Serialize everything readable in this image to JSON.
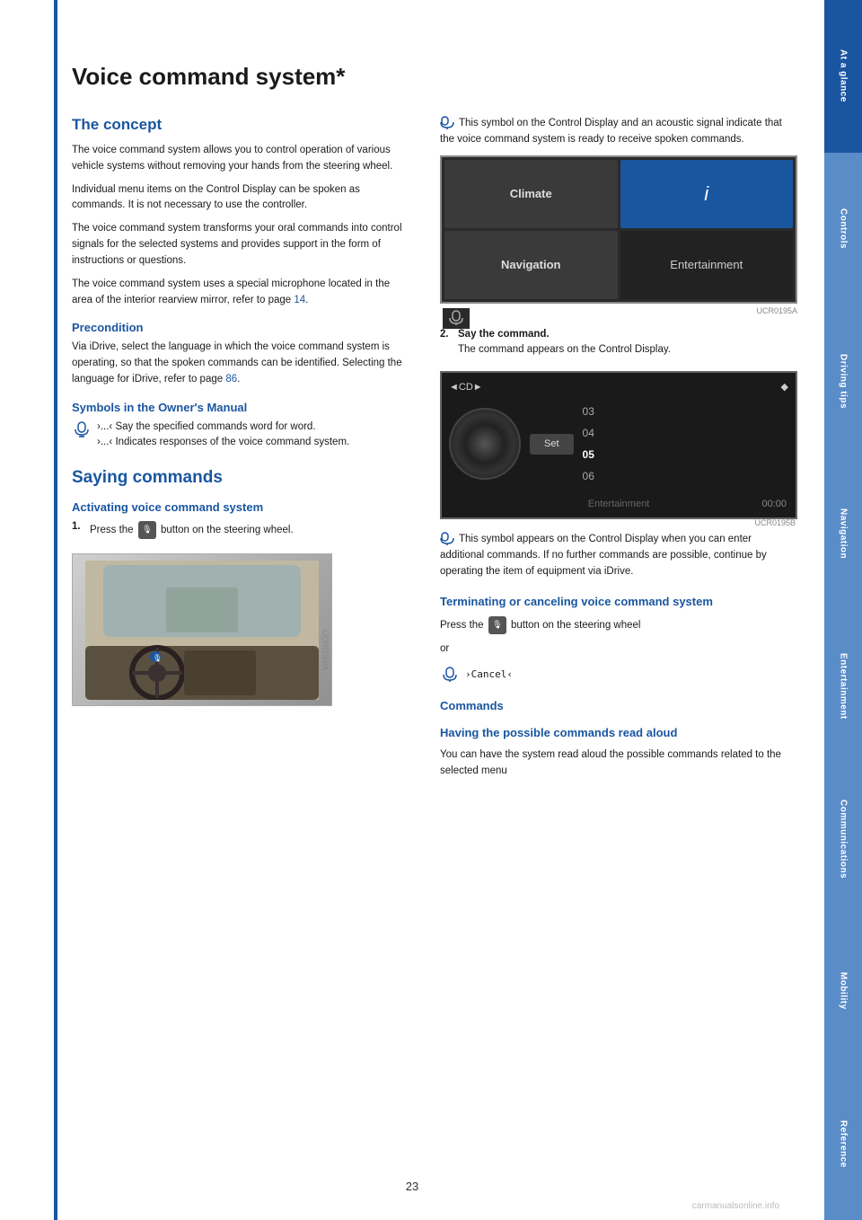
{
  "page": {
    "title": "Voice command system*",
    "page_number": "23",
    "watermark": "carmanualsonline.info"
  },
  "sidebar": {
    "items": [
      {
        "id": "s1",
        "label": "At a glance",
        "active": true
      },
      {
        "id": "s2",
        "label": "Controls"
      },
      {
        "id": "s3",
        "label": "Driving tips"
      },
      {
        "id": "s4",
        "label": "Navigation"
      },
      {
        "id": "s5",
        "label": "Entertainment"
      },
      {
        "id": "s6",
        "label": "Communications"
      },
      {
        "id": "s7",
        "label": "Mobility"
      },
      {
        "id": "s8",
        "label": "Reference"
      }
    ]
  },
  "left_col": {
    "concept_title": "The concept",
    "concept_paragraphs": [
      "The voice command system allows you to control operation of various vehicle systems without removing your hands from the steering wheel.",
      "Individual menu items on the Control Display can be spoken as commands. It is not necessary to use the controller.",
      "The voice command system transforms your oral commands into control signals for the selected systems and provides support in the form of instructions or questions.",
      "The voice command system uses a special microphone located in the area of the interior rearview mirror, refer to page 14."
    ],
    "precondition_title": "Precondition",
    "precondition_text": "Via iDrive, select the language in which the voice command system is operating, so that the spoken commands can be identified. Selecting the language for iDrive, refer to page 86.",
    "symbols_title": "Symbols in the Owner's Manual",
    "symbol1_text": "›...‹ Say the specified commands word for word.",
    "symbol2_text": "›...‹ Indicates responses of the voice command system.",
    "saying_title": "Saying commands",
    "activating_title": "Activating voice command system",
    "step1_text": "Press the",
    "step1_suffix": "button on the steering wheel.",
    "page_ref_14": "14",
    "page_ref_86": "86"
  },
  "right_col": {
    "symbol_intro": "This symbol on the Control Display and an acoustic signal indicate that the voice command system is ready to receive spoken commands.",
    "step2_label": "2.",
    "step2_text": "Say the command.",
    "step2_sub": "The command appears on the Control Display.",
    "cd_tracks": [
      "03",
      "04",
      "05",
      "06"
    ],
    "cd_time": "00:00",
    "cd_header": "◄  CD  ►",
    "cd_set": "Set",
    "entertainment_label": "Entertainment",
    "symbol_additional": "This symbol appears on the Control Display when you can enter additional commands. If no further commands are possible, continue by operating the item of equipment via iDrive.",
    "terminating_title": "Terminating or canceling voice command system",
    "terminating_text1": "Press the",
    "terminating_text2": "button on the steering wheel",
    "terminating_or": "or",
    "cancel_command": "›Cancel‹",
    "commands_title": "Commands",
    "commands_read_title": "Having the possible commands read aloud",
    "commands_read_text": "You can have the system read aloud the possible commands related to the selected menu"
  },
  "climate_label": "Climate",
  "navigation_label": "Navigation",
  "info_label": "i",
  "entertainment_label2": "Entertainment"
}
